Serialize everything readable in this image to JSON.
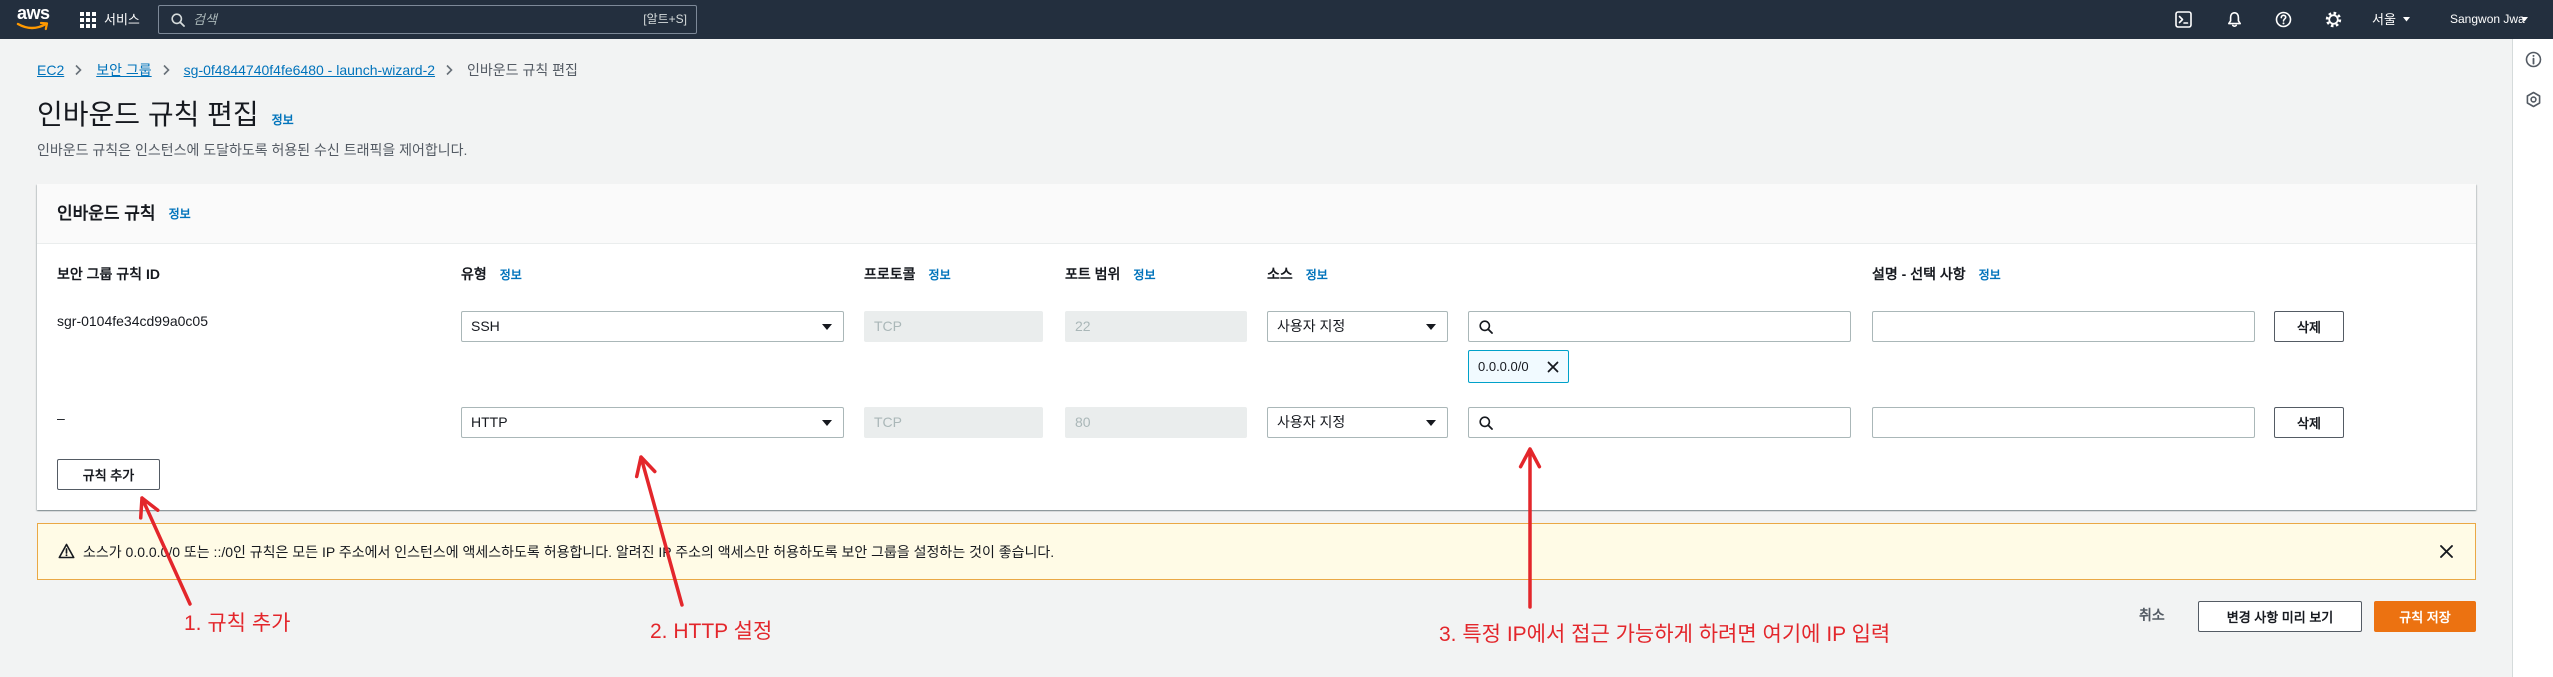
{
  "nav": {
    "logo_text": "aws",
    "services_label": "서비스",
    "search_placeholder": "검색",
    "search_shortcut": "[알트+S]",
    "region": "서울",
    "user": "Sangwon Jwa"
  },
  "breadcrumb": [
    "EC2",
    "보안 그룹",
    "sg-0f4844740f4fe6480 - launch-wizard-2",
    "인바운드 규칙 편집"
  ],
  "page": {
    "title": "인바운드 규칙 편집",
    "info": "정보",
    "description": "인바운드 규칙은 인스턴스에 도달하도록 허용된 수신 트래픽을 제어합니다."
  },
  "rules_card": {
    "title": "인바운드 규칙",
    "info": "정보",
    "columns": [
      {
        "label": "보안 그룹 규칙 ID"
      },
      {
        "label": "유형",
        "info": "정보"
      },
      {
        "label": "프로토콜",
        "info": "정보"
      },
      {
        "label": "포트 범위",
        "info": "정보"
      },
      {
        "label": "소스",
        "info": "정보"
      },
      {
        "label": "설명 - 선택 사항",
        "info": "정보"
      }
    ],
    "rows": [
      {
        "id": "sgr-0104fe34cd99a0c05",
        "type": "SSH",
        "protocol": "TCP",
        "port_range": "22",
        "source_type": "사용자 지정",
        "source_value": "",
        "source_tokens": [
          "0.0.0.0/0"
        ],
        "description": "",
        "delete_label": "삭제"
      },
      {
        "id": "–",
        "type": "HTTP",
        "protocol": "TCP",
        "port_range": "80",
        "source_type": "사용자 지정",
        "source_value": "",
        "source_tokens": [],
        "description": "",
        "delete_label": "삭제"
      }
    ],
    "add_rule_label": "규칙 추가"
  },
  "warning": {
    "message": "소스가 0.0.0.0/0 또는 ::/0인 규칙은 모든 IP 주소에서 인스턴스에 액세스하도록 허용합니다. 알려진 IP 주소의 액세스만 허용하도록 보안 그룹을 설정하는 것이 좋습니다."
  },
  "actions": {
    "cancel": "취소",
    "preview": "변경 사항 미리 보기",
    "save": "규칙 저장"
  },
  "annotations": [
    {
      "text": "1. 규칙 추가"
    },
    {
      "text": "2. HTTP 설정"
    },
    {
      "text": "3. 특정 IP에서 접근 가능하게 하려면 여기에 IP 입력"
    }
  ],
  "icons": {
    "nav": [
      "grid-icon",
      "search-icon",
      "terminal-icon",
      "bell-icon",
      "help-icon",
      "gear-icon",
      "caret-down-icon"
    ],
    "rail": [
      "info-icon",
      "hexagon-icon"
    ],
    "content": [
      "select-caret-icon",
      "search-icon",
      "token-close-icon",
      "warning-icon",
      "close-icon"
    ]
  },
  "colors": {
    "nav_bg": "#232f3e",
    "page_bg": "#f2f3f3",
    "link": "#0073bb",
    "primary_button": "#ec7211",
    "token_border": "#00a1c9",
    "warning_bg": "#fffbe6",
    "warning_border": "#eaa845",
    "annotation_red": "#e3262b"
  }
}
